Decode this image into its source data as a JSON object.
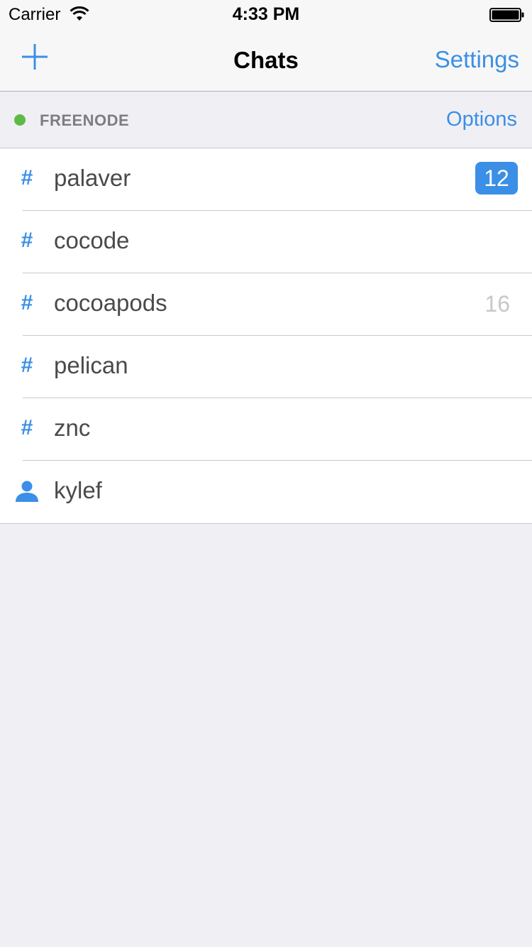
{
  "status_bar": {
    "carrier": "Carrier",
    "time": "4:33 PM"
  },
  "nav": {
    "title": "Chats",
    "settings_label": "Settings"
  },
  "section": {
    "network_name": "FREENODE",
    "options_label": "Options",
    "status_color": "#5dbb45"
  },
  "chats": [
    {
      "icon": "hash-icon",
      "name": "palaver",
      "badge": "12",
      "badge_style": "highlight"
    },
    {
      "icon": "hash-icon",
      "name": "cocode",
      "badge": ""
    },
    {
      "icon": "hash-icon",
      "name": "cocoapods",
      "badge": "16",
      "badge_style": "plain"
    },
    {
      "icon": "hash-icon",
      "name": "pelican",
      "badge": ""
    },
    {
      "icon": "hash-icon",
      "name": "znc",
      "badge": ""
    },
    {
      "icon": "person-icon",
      "name": "kylef",
      "badge": ""
    }
  ],
  "colors": {
    "accent": "#3b8fe6",
    "background": "#efeff4"
  }
}
